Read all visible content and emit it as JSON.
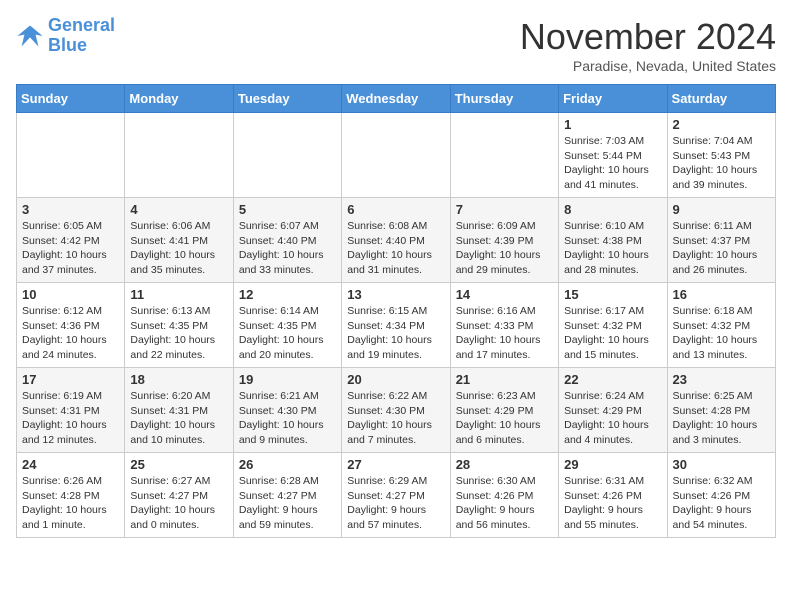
{
  "logo": {
    "line1": "General",
    "line2": "Blue"
  },
  "title": "November 2024",
  "location": "Paradise, Nevada, United States",
  "days_of_week": [
    "Sunday",
    "Monday",
    "Tuesday",
    "Wednesday",
    "Thursday",
    "Friday",
    "Saturday"
  ],
  "weeks": [
    [
      {
        "day": "",
        "info": ""
      },
      {
        "day": "",
        "info": ""
      },
      {
        "day": "",
        "info": ""
      },
      {
        "day": "",
        "info": ""
      },
      {
        "day": "",
        "info": ""
      },
      {
        "day": "1",
        "info": "Sunrise: 7:03 AM\nSunset: 5:44 PM\nDaylight: 10 hours and 41 minutes."
      },
      {
        "day": "2",
        "info": "Sunrise: 7:04 AM\nSunset: 5:43 PM\nDaylight: 10 hours and 39 minutes."
      }
    ],
    [
      {
        "day": "3",
        "info": "Sunrise: 6:05 AM\nSunset: 4:42 PM\nDaylight: 10 hours and 37 minutes."
      },
      {
        "day": "4",
        "info": "Sunrise: 6:06 AM\nSunset: 4:41 PM\nDaylight: 10 hours and 35 minutes."
      },
      {
        "day": "5",
        "info": "Sunrise: 6:07 AM\nSunset: 4:40 PM\nDaylight: 10 hours and 33 minutes."
      },
      {
        "day": "6",
        "info": "Sunrise: 6:08 AM\nSunset: 4:40 PM\nDaylight: 10 hours and 31 minutes."
      },
      {
        "day": "7",
        "info": "Sunrise: 6:09 AM\nSunset: 4:39 PM\nDaylight: 10 hours and 29 minutes."
      },
      {
        "day": "8",
        "info": "Sunrise: 6:10 AM\nSunset: 4:38 PM\nDaylight: 10 hours and 28 minutes."
      },
      {
        "day": "9",
        "info": "Sunrise: 6:11 AM\nSunset: 4:37 PM\nDaylight: 10 hours and 26 minutes."
      }
    ],
    [
      {
        "day": "10",
        "info": "Sunrise: 6:12 AM\nSunset: 4:36 PM\nDaylight: 10 hours and 24 minutes."
      },
      {
        "day": "11",
        "info": "Sunrise: 6:13 AM\nSunset: 4:35 PM\nDaylight: 10 hours and 22 minutes."
      },
      {
        "day": "12",
        "info": "Sunrise: 6:14 AM\nSunset: 4:35 PM\nDaylight: 10 hours and 20 minutes."
      },
      {
        "day": "13",
        "info": "Sunrise: 6:15 AM\nSunset: 4:34 PM\nDaylight: 10 hours and 19 minutes."
      },
      {
        "day": "14",
        "info": "Sunrise: 6:16 AM\nSunset: 4:33 PM\nDaylight: 10 hours and 17 minutes."
      },
      {
        "day": "15",
        "info": "Sunrise: 6:17 AM\nSunset: 4:32 PM\nDaylight: 10 hours and 15 minutes."
      },
      {
        "day": "16",
        "info": "Sunrise: 6:18 AM\nSunset: 4:32 PM\nDaylight: 10 hours and 13 minutes."
      }
    ],
    [
      {
        "day": "17",
        "info": "Sunrise: 6:19 AM\nSunset: 4:31 PM\nDaylight: 10 hours and 12 minutes."
      },
      {
        "day": "18",
        "info": "Sunrise: 6:20 AM\nSunset: 4:31 PM\nDaylight: 10 hours and 10 minutes."
      },
      {
        "day": "19",
        "info": "Sunrise: 6:21 AM\nSunset: 4:30 PM\nDaylight: 10 hours and 9 minutes."
      },
      {
        "day": "20",
        "info": "Sunrise: 6:22 AM\nSunset: 4:30 PM\nDaylight: 10 hours and 7 minutes."
      },
      {
        "day": "21",
        "info": "Sunrise: 6:23 AM\nSunset: 4:29 PM\nDaylight: 10 hours and 6 minutes."
      },
      {
        "day": "22",
        "info": "Sunrise: 6:24 AM\nSunset: 4:29 PM\nDaylight: 10 hours and 4 minutes."
      },
      {
        "day": "23",
        "info": "Sunrise: 6:25 AM\nSunset: 4:28 PM\nDaylight: 10 hours and 3 minutes."
      }
    ],
    [
      {
        "day": "24",
        "info": "Sunrise: 6:26 AM\nSunset: 4:28 PM\nDaylight: 10 hours and 1 minute."
      },
      {
        "day": "25",
        "info": "Sunrise: 6:27 AM\nSunset: 4:27 PM\nDaylight: 10 hours and 0 minutes."
      },
      {
        "day": "26",
        "info": "Sunrise: 6:28 AM\nSunset: 4:27 PM\nDaylight: 9 hours and 59 minutes."
      },
      {
        "day": "27",
        "info": "Sunrise: 6:29 AM\nSunset: 4:27 PM\nDaylight: 9 hours and 57 minutes."
      },
      {
        "day": "28",
        "info": "Sunrise: 6:30 AM\nSunset: 4:26 PM\nDaylight: 9 hours and 56 minutes."
      },
      {
        "day": "29",
        "info": "Sunrise: 6:31 AM\nSunset: 4:26 PM\nDaylight: 9 hours and 55 minutes."
      },
      {
        "day": "30",
        "info": "Sunrise: 6:32 AM\nSunset: 4:26 PM\nDaylight: 9 hours and 54 minutes."
      }
    ]
  ]
}
